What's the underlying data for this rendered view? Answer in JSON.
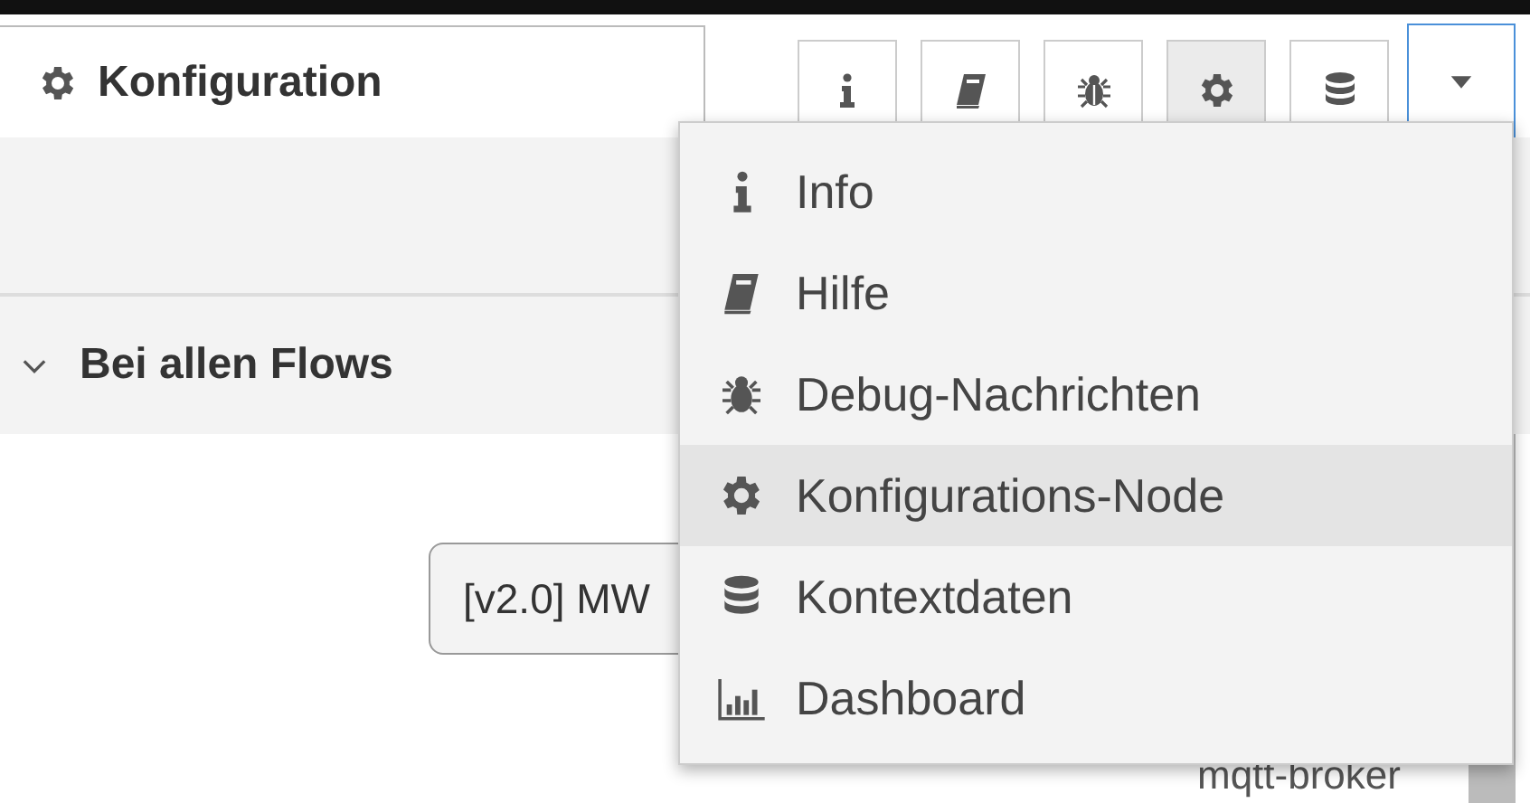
{
  "panel": {
    "title": "Konfiguration"
  },
  "toolbar": [
    {
      "kind": "info",
      "selected": false
    },
    {
      "kind": "book",
      "selected": false
    },
    {
      "kind": "bug",
      "selected": false
    },
    {
      "kind": "gear",
      "selected": true
    },
    {
      "kind": "database",
      "selected": false
    }
  ],
  "dropdown": {
    "open": true
  },
  "menu": [
    {
      "label": "Info",
      "kind": "info",
      "selected": false
    },
    {
      "label": "Hilfe",
      "kind": "book",
      "selected": false
    },
    {
      "label": "Debug-Nachrichten",
      "kind": "bug",
      "selected": false
    },
    {
      "label": "Konfigurations-Node",
      "kind": "gear",
      "selected": true
    },
    {
      "label": "Kontextdaten",
      "kind": "database",
      "selected": false
    },
    {
      "label": "Dashboard",
      "kind": "chart",
      "selected": false
    }
  ],
  "section": {
    "title": "Bei allen Flows",
    "expanded": true
  },
  "config_node": {
    "label": "[v2.0] MW",
    "type": "mqtt-broker"
  }
}
